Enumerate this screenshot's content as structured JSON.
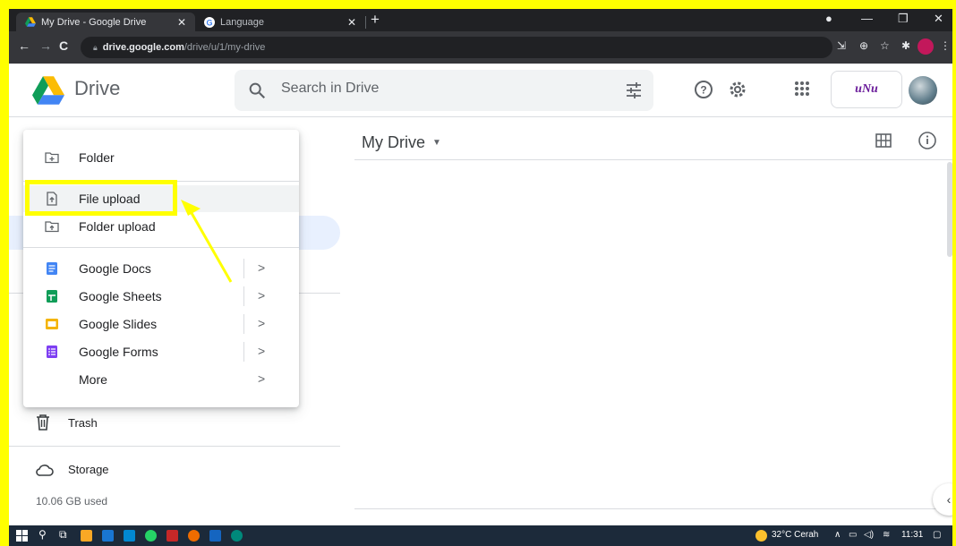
{
  "browser": {
    "tabs": [
      {
        "title": "My Drive - Google Drive",
        "active": true
      },
      {
        "title": "Language",
        "active": false
      }
    ],
    "url_host": "drive.google.com",
    "url_path": "/drive/u/1/my-drive"
  },
  "header": {
    "app_name": "Drive",
    "search_placeholder": "Search in Drive",
    "account_logo": "uNu"
  },
  "menu": {
    "items": [
      {
        "label": "Folder",
        "icon": "folder-plus-icon"
      },
      {
        "label": "File upload",
        "icon": "file-upload-icon"
      },
      {
        "label": "Folder upload",
        "icon": "folder-upload-icon"
      },
      {
        "label": "Google Docs",
        "icon": "docs-icon",
        "color": "#4285f4"
      },
      {
        "label": "Google Sheets",
        "icon": "sheets-icon",
        "color": "#0f9d58"
      },
      {
        "label": "Google Slides",
        "icon": "slides-icon",
        "color": "#f4b400"
      },
      {
        "label": "Google Forms",
        "icon": "forms-icon",
        "color": "#7e3ff2"
      },
      {
        "label": "More"
      }
    ],
    "arrow": ">"
  },
  "sidebar": {
    "trash_label": "Trash",
    "storage_label": "Storage",
    "storage_used": "10.06 GB used"
  },
  "main": {
    "title": "My Drive"
  },
  "taskbar": {
    "weather": "32°C  Cerah",
    "time": "11:31"
  },
  "colors": {
    "annotation": "#ffff00",
    "accent": "#1a73e8"
  }
}
